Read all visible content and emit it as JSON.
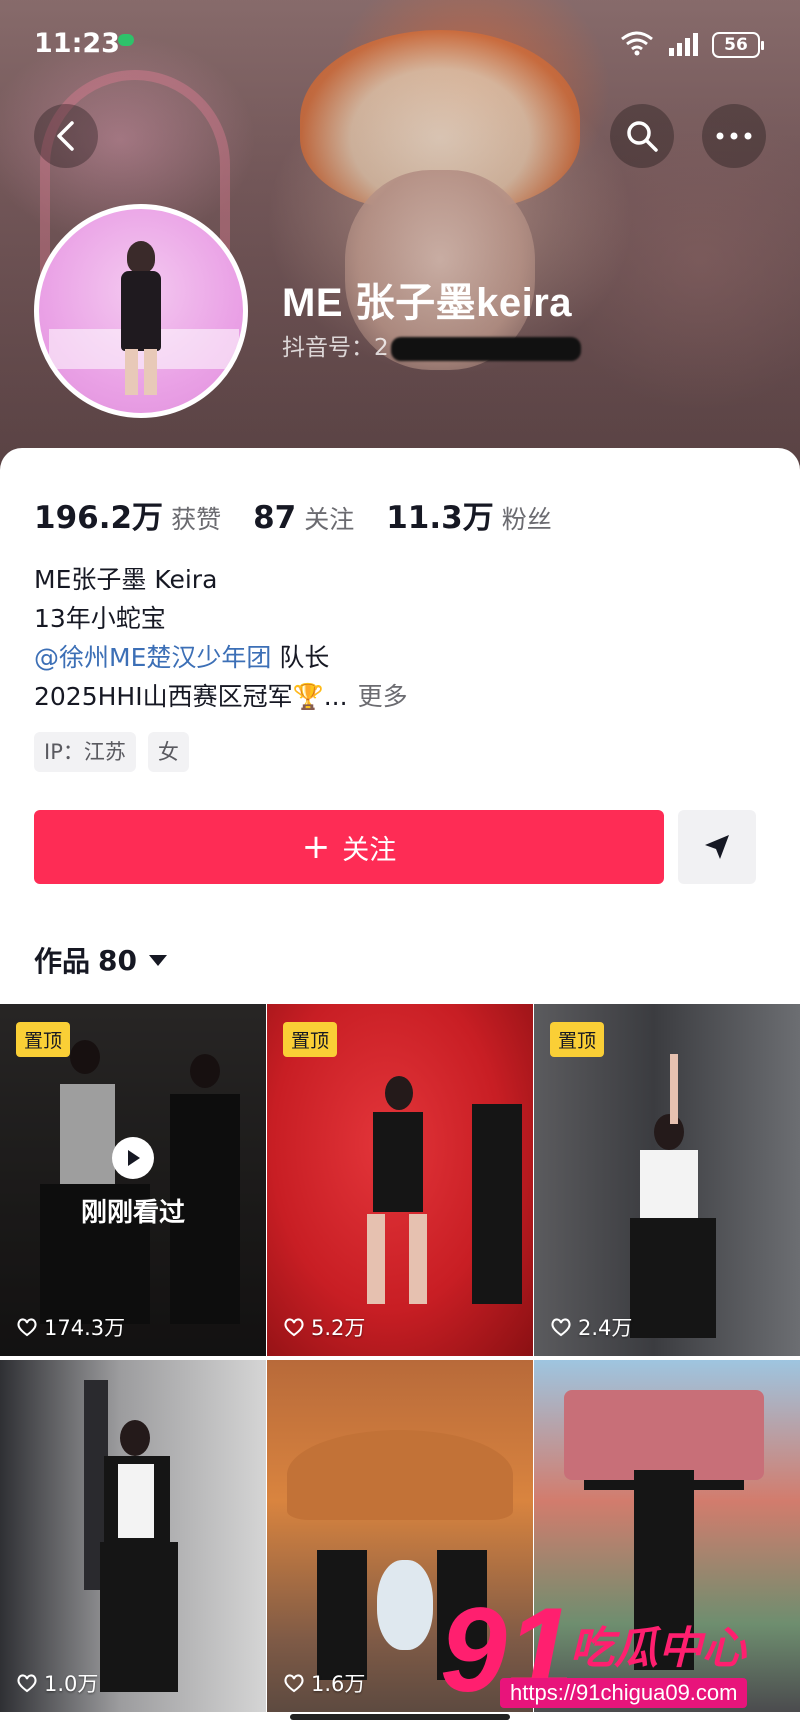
{
  "status_bar": {
    "time": "11:23",
    "battery": "56"
  },
  "profile": {
    "name": "ME 张子墨keira",
    "douyin_id_label": "抖音号：2"
  },
  "stats": [
    {
      "value": "196.2万",
      "label": "获赞"
    },
    {
      "value": "87",
      "label": "关注"
    },
    {
      "value": "11.3万",
      "label": "粉丝"
    }
  ],
  "bio": {
    "line1": "ME张子墨 Keira",
    "line2": "13年小蛇宝",
    "mention": "@徐州ME楚汉少年团",
    "mention_suffix": " 队长",
    "line4": "2025HHI山西赛区冠军🏆...",
    "more": "更多"
  },
  "tags": [
    "IP：江苏",
    "女"
  ],
  "actions": {
    "follow_label": "关注",
    "follow_plus": "+"
  },
  "works": {
    "label": "作品",
    "count": "80"
  },
  "grid": {
    "pin_label": "置顶",
    "watched_label": "刚刚看过",
    "likes": [
      "174.3万",
      "5.2万",
      "2.4万",
      "1.0万",
      "1.6万",
      ""
    ]
  },
  "watermark": {
    "number": "91",
    "text": "吃瓜中心",
    "url": "https://91chigua09.com"
  },
  "colors": {
    "accent": "#fe2c55",
    "mention": "#3c6fb6",
    "pin": "#facf36",
    "watermark": "#ff1f6f"
  }
}
